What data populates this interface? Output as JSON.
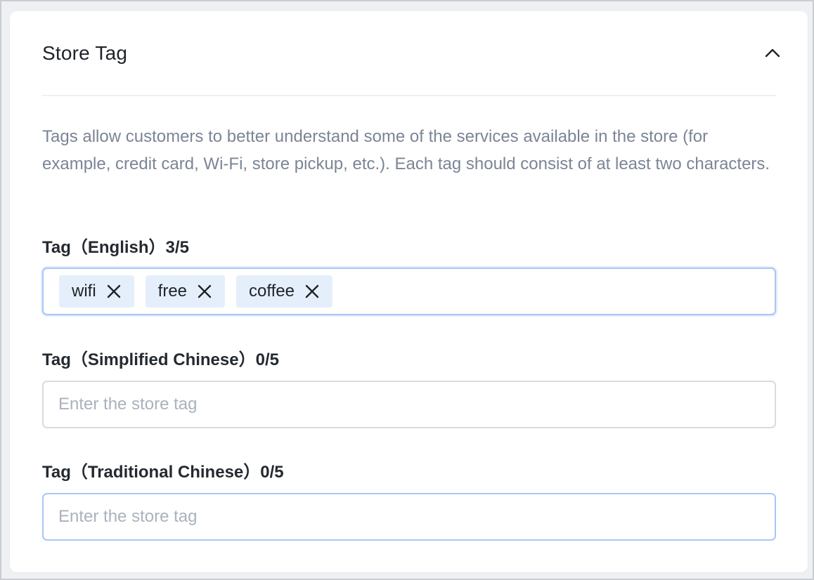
{
  "section": {
    "title": "Store Tag",
    "description": "Tags allow customers to better understand some of the services available in the store (for example, credit card, Wi-Fi, store pickup, etc.). Each tag should consist of at least two characters.",
    "collapse_icon": "chevron-up-icon"
  },
  "fields": {
    "english": {
      "label": "Tag（English）3/5",
      "tags": [
        {
          "text": "wifi",
          "remove_icon": "close-icon"
        },
        {
          "text": "free",
          "remove_icon": "close-icon"
        },
        {
          "text": "coffee",
          "remove_icon": "close-icon"
        }
      ]
    },
    "simplified_chinese": {
      "label": "Tag（Simplified Chinese）0/5",
      "value": "",
      "placeholder": "Enter the store tag"
    },
    "traditional_chinese": {
      "label": "Tag（Traditional Chinese）0/5",
      "value": "",
      "placeholder": "Enter the store tag"
    }
  },
  "colors": {
    "chip_background": "#e5effc",
    "focus_border": "#a9c6f5",
    "description_text": "#7b8595",
    "placeholder_text": "#aab2bd"
  }
}
